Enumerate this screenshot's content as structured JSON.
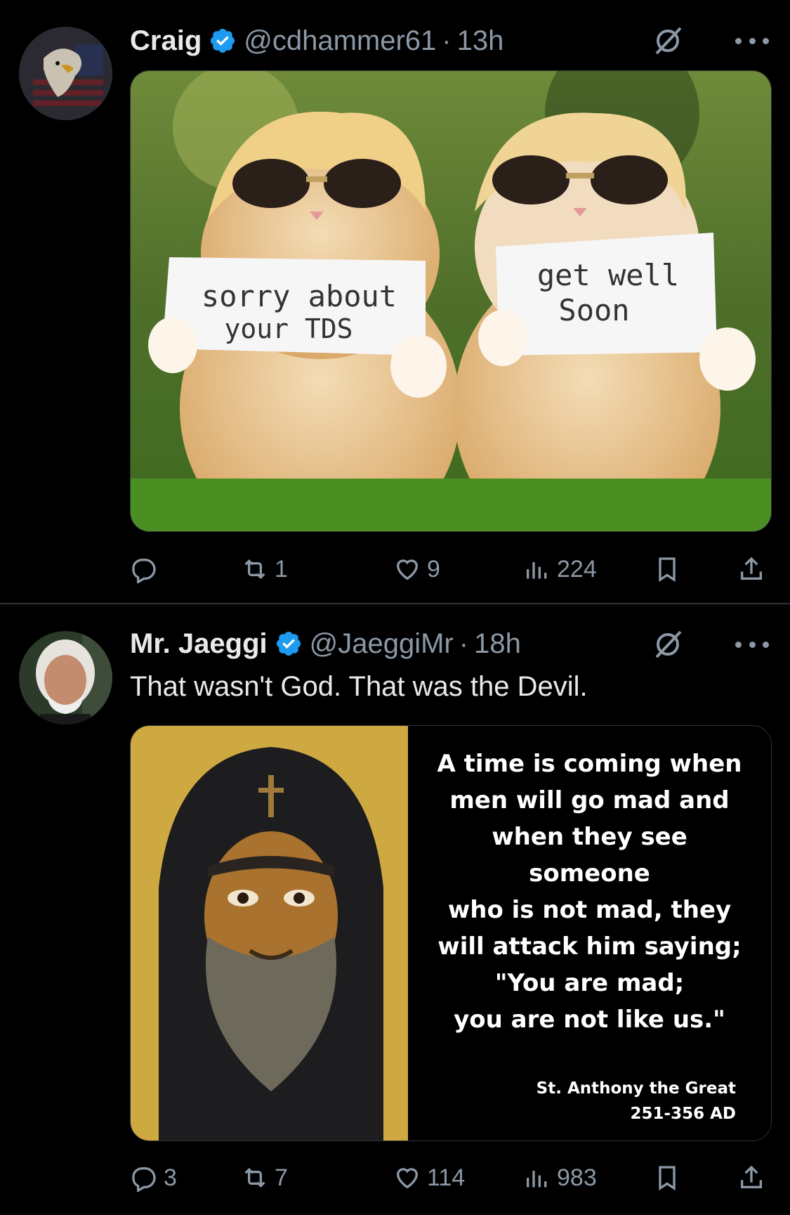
{
  "tweets": [
    {
      "author": {
        "name": "Craig",
        "handle": "@cdhammer61",
        "time": "13h",
        "avatar": "eagle-flag-avatar"
      },
      "text": "",
      "media": {
        "description_icon": "cats-image",
        "sign_left_line1": "sorry about",
        "sign_left_line2": "your TDS",
        "sign_right_line1": "get well",
        "sign_right_line2": "Soon"
      },
      "actions": {
        "replies": "",
        "reposts": "1",
        "likes": "9",
        "views": "224"
      }
    },
    {
      "author": {
        "name": "Mr. Jaeggi",
        "handle": "@JaeggiMr",
        "time": "18h",
        "avatar": "man-portrait-avatar"
      },
      "text": "That wasn't God. That was the Devil.",
      "media": {
        "description_icon": "saint-icon-image",
        "quote": "A time is coming when\nmen will go mad and\nwhen they see\nsomeone\nwho is not mad, they\nwill attack him saying;\n\"You are mad;\nyou are not like us.\"",
        "attribution_line1": "St. Anthony the Great",
        "attribution_line2": "251-356 AD"
      },
      "actions": {
        "replies": "3",
        "reposts": "7",
        "likes": "114",
        "views": "983"
      }
    }
  ],
  "colors": {
    "background": "#000000",
    "text_primary": "#e7e9ea",
    "text_secondary": "#8b98a5",
    "verified_blue": "#1d9bf0",
    "divider": "#2f3336"
  }
}
